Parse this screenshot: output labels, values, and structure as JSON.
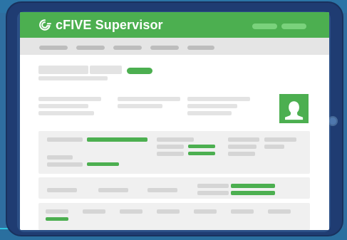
{
  "app": {
    "brand_title": "cFIVE Supervisor",
    "accent_color": "#4caf50",
    "header_bg": "#4caf50",
    "frame_color": "#1f3c72"
  },
  "icons": {
    "brand_logo": "cfive-logo-icon",
    "avatar": "user-avatar-icon",
    "home_button": "tablet-home-button-icon"
  }
}
